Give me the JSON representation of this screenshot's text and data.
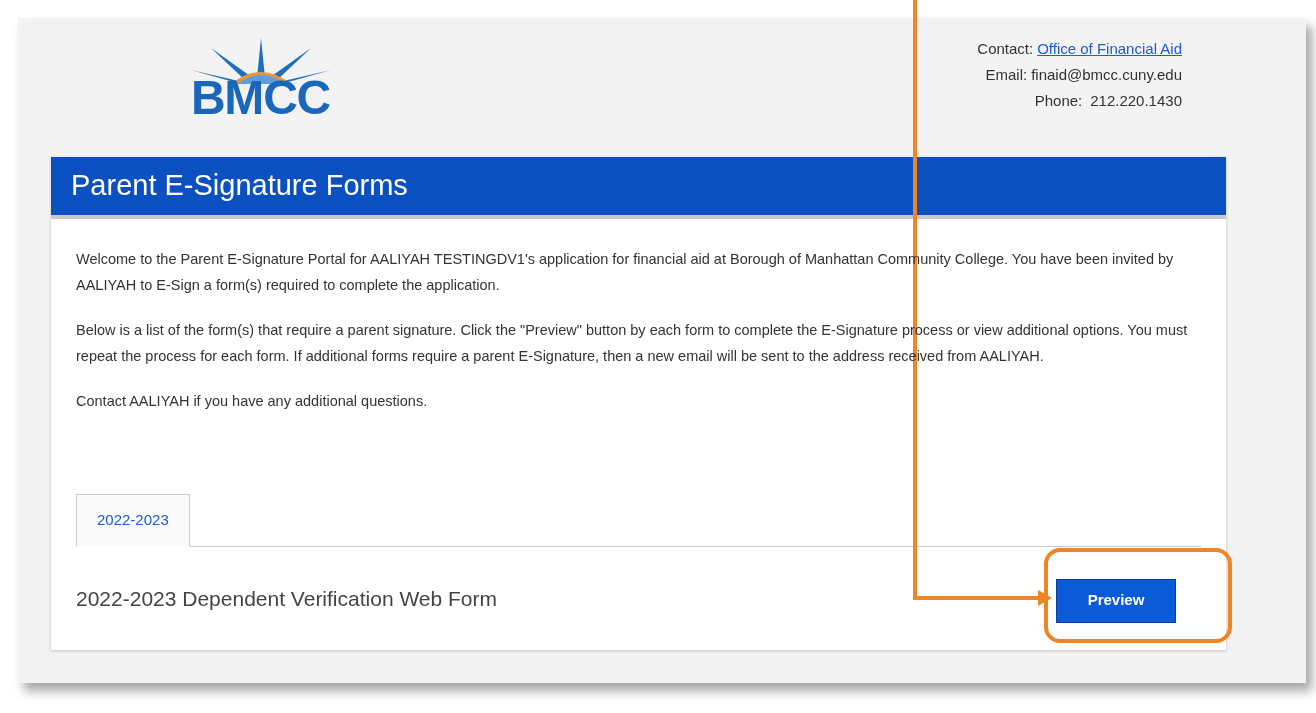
{
  "logo": {
    "text": "BMCC"
  },
  "contact": {
    "label": "Contact:",
    "link": "Office of Financial Aid",
    "email_label": "Email:",
    "email": "finaid@bmcc.cuny.edu",
    "phone_label": "Phone:",
    "phone": "212.220.1430"
  },
  "header": {
    "title": "Parent E-Signature Forms"
  },
  "paragraphs": [
    "Welcome to the Parent E-Signature Portal for AALIYAH TESTINGDV1's application for financial aid at Borough of Manhattan Community College. You have been invited by AALIYAH to E-Sign a form(s) required to complete the application.",
    "Below is a list of the form(s) that require a parent signature. Click the \"Preview\" button by each form to complete the E-Signature process or view additional options. You must repeat the process for each form. If additional forms require a parent E-Signature, then a new email will be sent to the address received from AALIYAH.",
    "Contact AALIYAH if you have any additional questions."
  ],
  "tabs": [
    {
      "label": "2022-2023",
      "selected": true
    }
  ],
  "forms": [
    {
      "title": "2022-2023 Dependent Verification Web Form",
      "button": "Preview"
    }
  ]
}
